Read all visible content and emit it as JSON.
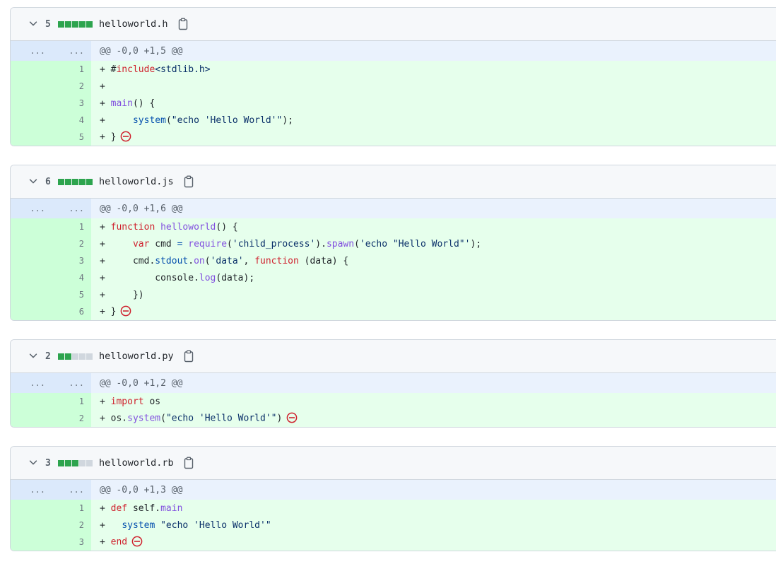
{
  "files": [
    {
      "count": "5",
      "stat": [
        "add",
        "add",
        "add",
        "add",
        "add"
      ],
      "name": "helloworld.h",
      "hunk": "@@ -0,0 +1,5 @@",
      "hunk_gutter": [
        "...",
        "..."
      ],
      "lines": [
        {
          "n": "1",
          "tokens": [
            [
              "+ #",
              ""
            ],
            [
              "include",
              "kw"
            ],
            [
              "<stdlib.h>",
              "st"
            ]
          ]
        },
        {
          "n": "2",
          "tokens": [
            [
              "+",
              ""
            ]
          ]
        },
        {
          "n": "3",
          "tokens": [
            [
              "+ ",
              ""
            ],
            [
              "main",
              "fn"
            ],
            [
              "() {",
              ""
            ]
          ]
        },
        {
          "n": "4",
          "tokens": [
            [
              "+     ",
              ""
            ],
            [
              "system",
              "pr"
            ],
            [
              "(",
              ""
            ],
            [
              "\"echo 'Hello World'\"",
              "st"
            ],
            [
              ");",
              ""
            ]
          ]
        },
        {
          "n": "5",
          "tokens": [
            [
              "+ }",
              ""
            ]
          ],
          "end": true
        }
      ]
    },
    {
      "count": "6",
      "stat": [
        "add",
        "add",
        "add",
        "add",
        "add"
      ],
      "name": "helloworld.js",
      "hunk": "@@ -0,0 +1,6 @@",
      "hunk_gutter": [
        "...",
        "..."
      ],
      "lines": [
        {
          "n": "1",
          "tokens": [
            [
              "+ ",
              ""
            ],
            [
              "function",
              "kw"
            ],
            [
              " ",
              ""
            ],
            [
              "helloworld",
              "fn"
            ],
            [
              "() {",
              ""
            ]
          ]
        },
        {
          "n": "2",
          "tokens": [
            [
              "+     ",
              ""
            ],
            [
              "var",
              "kw"
            ],
            [
              " cmd ",
              ""
            ],
            [
              "=",
              "pr"
            ],
            [
              " ",
              ""
            ],
            [
              "require",
              "fn"
            ],
            [
              "(",
              ""
            ],
            [
              "'child_process'",
              "st"
            ],
            [
              ").",
              ""
            ],
            [
              "spawn",
              "fn"
            ],
            [
              "(",
              ""
            ],
            [
              "'echo \"Hello World\"'",
              "st"
            ],
            [
              ");",
              ""
            ]
          ]
        },
        {
          "n": "3",
          "tokens": [
            [
              "+     cmd.",
              ""
            ],
            [
              "stdout",
              "pr"
            ],
            [
              ".",
              ""
            ],
            [
              "on",
              "fn"
            ],
            [
              "(",
              ""
            ],
            [
              "'data'",
              "st"
            ],
            [
              ", ",
              ""
            ],
            [
              "function",
              "kw"
            ],
            [
              " (data) {",
              ""
            ]
          ]
        },
        {
          "n": "4",
          "tokens": [
            [
              "+         console.",
              ""
            ],
            [
              "log",
              "fn"
            ],
            [
              "(data);",
              ""
            ]
          ]
        },
        {
          "n": "5",
          "tokens": [
            [
              "+     })",
              ""
            ]
          ]
        },
        {
          "n": "6",
          "tokens": [
            [
              "+ }",
              ""
            ]
          ],
          "end": true
        }
      ]
    },
    {
      "count": "2",
      "stat": [
        "add",
        "add",
        "neu",
        "neu",
        "neu"
      ],
      "name": "helloworld.py",
      "hunk": "@@ -0,0 +1,2 @@",
      "hunk_gutter": [
        "...",
        "..."
      ],
      "lines": [
        {
          "n": "1",
          "tokens": [
            [
              "+ ",
              ""
            ],
            [
              "import",
              "kw"
            ],
            [
              " os",
              ""
            ]
          ]
        },
        {
          "n": "2",
          "tokens": [
            [
              "+ os.",
              ""
            ],
            [
              "system",
              "fn"
            ],
            [
              "(",
              ""
            ],
            [
              "\"echo 'Hello World'\"",
              "st"
            ],
            [
              ")",
              ""
            ]
          ],
          "end": true
        }
      ]
    },
    {
      "count": "3",
      "stat": [
        "add",
        "add",
        "add",
        "neu",
        "neu"
      ],
      "name": "helloworld.rb",
      "hunk": "@@ -0,0 +1,3 @@",
      "hunk_gutter": [
        "...",
        "..."
      ],
      "lines": [
        {
          "n": "1",
          "tokens": [
            [
              "+ ",
              ""
            ],
            [
              "def",
              "kw"
            ],
            [
              " self.",
              ""
            ],
            [
              "main",
              "fn"
            ]
          ]
        },
        {
          "n": "2",
          "tokens": [
            [
              "+   ",
              ""
            ],
            [
              "system",
              "pr"
            ],
            [
              " ",
              ""
            ],
            [
              "\"echo 'Hello World'\"",
              "st"
            ]
          ]
        },
        {
          "n": "3",
          "tokens": [
            [
              "+ ",
              ""
            ],
            [
              "end",
              "kw"
            ]
          ],
          "end": true
        }
      ]
    }
  ],
  "icons": {
    "chevron": "chevron-down-icon",
    "copy": "clipboard-icon",
    "no_newline": "no-entry-icon"
  },
  "colors": {
    "addition": "#e6ffec",
    "addition_gutter": "#ccffd8",
    "hunk": "#eaf2fd",
    "stat_add": "#2da44e",
    "stat_neutral": "#d0d7de"
  }
}
